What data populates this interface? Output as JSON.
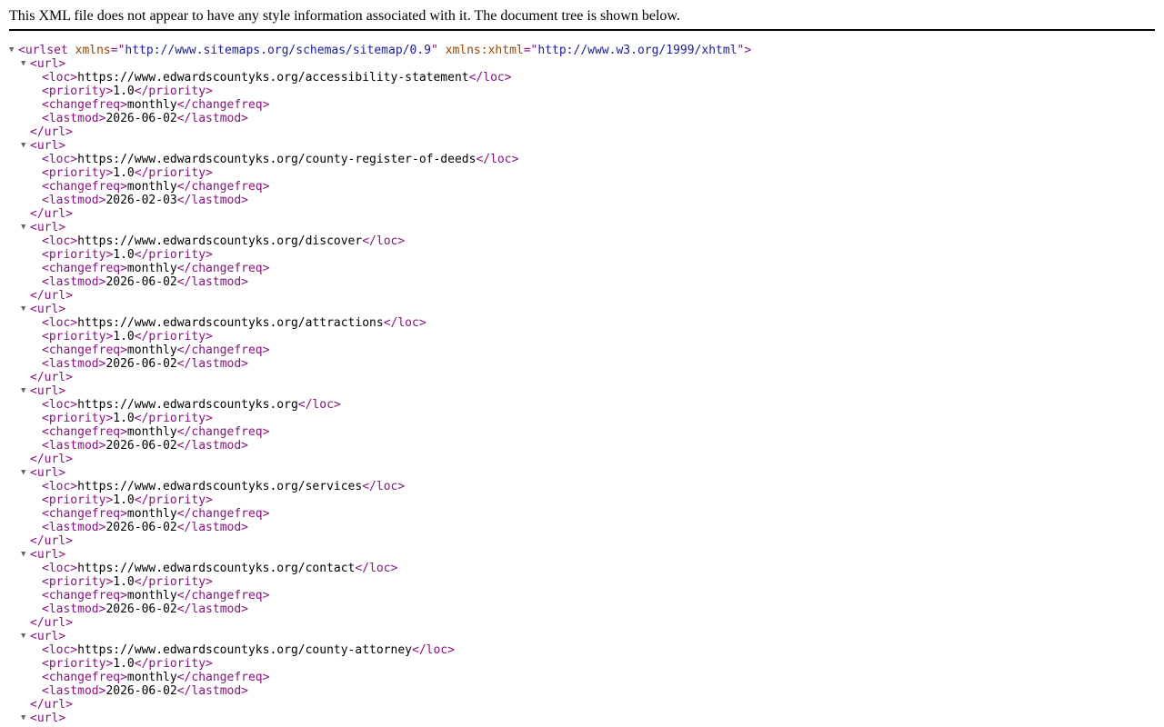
{
  "header": {
    "message": "This XML file does not appear to have any style information associated with it. The document tree is shown below."
  },
  "colors": {
    "tag": "#881280",
    "attribute_name": "#994500",
    "attribute_value": "#1a1aa6",
    "text": "#000000"
  },
  "icons": {
    "toggle": "disclosure-triangle-down-icon"
  },
  "tree": {
    "root_tag": "urlset",
    "attributes": [
      {
        "name": "xmlns",
        "value": "http://www.sitemaps.org/schemas/sitemap/0.9"
      },
      {
        "name": "xmlns:xhtml",
        "value": "http://www.w3.org/1999/xhtml"
      }
    ],
    "url_tag": "url",
    "fields": [
      "loc",
      "priority",
      "changefreq",
      "lastmod"
    ],
    "urls": [
      {
        "loc": "https://www.edwardscountyks.org/accessibility-statement",
        "priority": "1.0",
        "changefreq": "monthly",
        "lastmod": "2026-06-02"
      },
      {
        "loc": "https://www.edwardscountyks.org/county-register-of-deeds",
        "priority": "1.0",
        "changefreq": "monthly",
        "lastmod": "2026-02-03"
      },
      {
        "loc": "https://www.edwardscountyks.org/discover",
        "priority": "1.0",
        "changefreq": "monthly",
        "lastmod": "2026-06-02"
      },
      {
        "loc": "https://www.edwardscountyks.org/attractions",
        "priority": "1.0",
        "changefreq": "monthly",
        "lastmod": "2026-06-02"
      },
      {
        "loc": "https://www.edwardscountyks.org",
        "priority": "1.0",
        "changefreq": "monthly",
        "lastmod": "2026-06-02"
      },
      {
        "loc": "https://www.edwardscountyks.org/services",
        "priority": "1.0",
        "changefreq": "monthly",
        "lastmod": "2026-06-02"
      },
      {
        "loc": "https://www.edwardscountyks.org/contact",
        "priority": "1.0",
        "changefreq": "monthly",
        "lastmod": "2026-06-02"
      },
      {
        "loc": "https://www.edwardscountyks.org/county-attorney",
        "priority": "1.0",
        "changefreq": "monthly",
        "lastmod": "2026-06-02"
      }
    ],
    "trailing_open_url": true
  }
}
